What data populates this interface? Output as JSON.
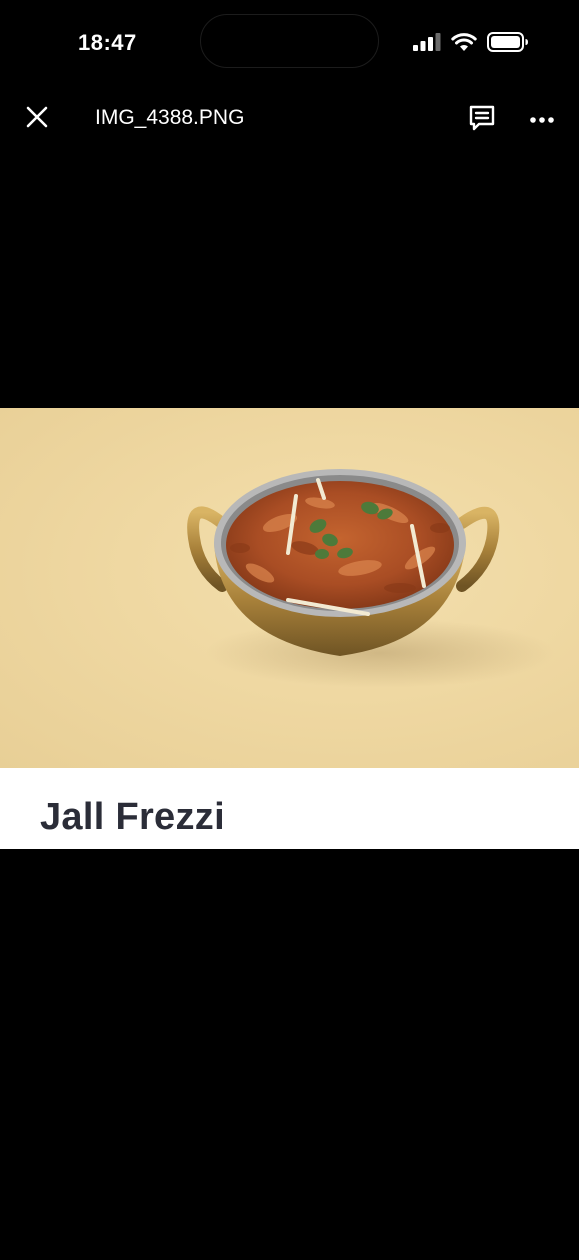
{
  "status_bar": {
    "time": "18:47",
    "icons": [
      "cellular-signal-icon",
      "wifi-icon",
      "battery-icon"
    ]
  },
  "nav": {
    "file_name": "IMG_4388.PNG",
    "close_icon": "close-icon",
    "comments_icon": "comments-icon",
    "more_icon": "more-options-icon"
  },
  "image": {
    "caption": "Jall Frezzi",
    "background_color": "#efd8a2",
    "caption_text_color": "#2b2d38"
  }
}
